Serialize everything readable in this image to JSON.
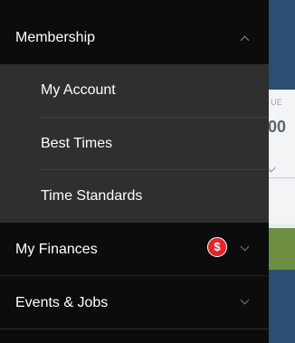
{
  "background": {
    "card_label": "UE",
    "card_value": "00"
  },
  "menu": {
    "membership": {
      "label": "Membership",
      "expanded": true,
      "items": [
        {
          "label": "My Account"
        },
        {
          "label": "Best Times"
        },
        {
          "label": "Time Standards"
        }
      ]
    },
    "my_finances": {
      "label": "My Finances",
      "badge": "$",
      "badge_color": "#e3242b"
    },
    "events_jobs": {
      "label": "Events & Jobs"
    }
  },
  "icons": {
    "collapse": "chevron-up-icon",
    "expand": "chevron-down-icon",
    "finance_alert": "dollar-badge-icon"
  },
  "colors": {
    "drawer_dark": "#0c0c0c",
    "submenu_bg": "#2f2f2f",
    "app_header": "#2a4e74",
    "app_green": "#6d8f3f"
  }
}
